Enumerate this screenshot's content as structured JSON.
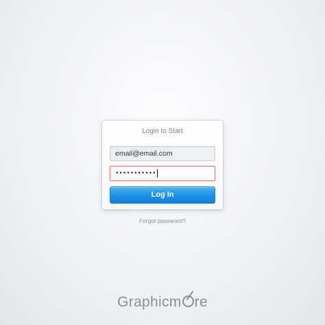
{
  "login_card": {
    "title": "Login to Start",
    "email_value": "email@email.com",
    "password_masked": "•••••••••••",
    "login_button_label": "Log In"
  },
  "forgot_password_label": "Forgot password?",
  "brand": {
    "text_before": "Graphicm",
    "text_after": "re",
    "logo_icon": "pen-o-logo-icon"
  },
  "colors": {
    "button_blue": "#1c8fe5",
    "error_border": "#e07a74",
    "background": "#eef0f3"
  }
}
